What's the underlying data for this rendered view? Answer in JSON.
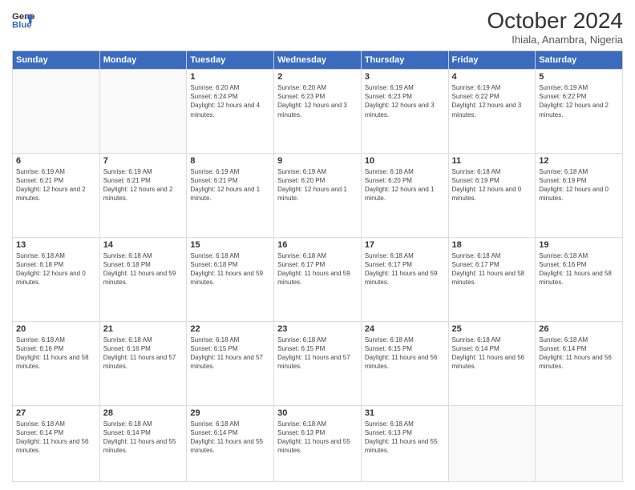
{
  "header": {
    "logo_line1": "General",
    "logo_line2": "Blue",
    "month": "October 2024",
    "location": "Ihiala, Anambra, Nigeria"
  },
  "weekdays": [
    "Sunday",
    "Monday",
    "Tuesday",
    "Wednesday",
    "Thursday",
    "Friday",
    "Saturday"
  ],
  "weeks": [
    [
      {
        "day": "",
        "info": ""
      },
      {
        "day": "",
        "info": ""
      },
      {
        "day": "1",
        "info": "Sunrise: 6:20 AM\nSunset: 6:24 PM\nDaylight: 12 hours and 4 minutes."
      },
      {
        "day": "2",
        "info": "Sunrise: 6:20 AM\nSunset: 6:23 PM\nDaylight: 12 hours and 3 minutes."
      },
      {
        "day": "3",
        "info": "Sunrise: 6:19 AM\nSunset: 6:23 PM\nDaylight: 12 hours and 3 minutes."
      },
      {
        "day": "4",
        "info": "Sunrise: 6:19 AM\nSunset: 6:22 PM\nDaylight: 12 hours and 3 minutes."
      },
      {
        "day": "5",
        "info": "Sunrise: 6:19 AM\nSunset: 6:22 PM\nDaylight: 12 hours and 2 minutes."
      }
    ],
    [
      {
        "day": "6",
        "info": "Sunrise: 6:19 AM\nSunset: 6:21 PM\nDaylight: 12 hours and 2 minutes."
      },
      {
        "day": "7",
        "info": "Sunrise: 6:19 AM\nSunset: 6:21 PM\nDaylight: 12 hours and 2 minutes."
      },
      {
        "day": "8",
        "info": "Sunrise: 6:19 AM\nSunset: 6:21 PM\nDaylight: 12 hours and 1 minute."
      },
      {
        "day": "9",
        "info": "Sunrise: 6:19 AM\nSunset: 6:20 PM\nDaylight: 12 hours and 1 minute."
      },
      {
        "day": "10",
        "info": "Sunrise: 6:18 AM\nSunset: 6:20 PM\nDaylight: 12 hours and 1 minute."
      },
      {
        "day": "11",
        "info": "Sunrise: 6:18 AM\nSunset: 6:19 PM\nDaylight: 12 hours and 0 minutes."
      },
      {
        "day": "12",
        "info": "Sunrise: 6:18 AM\nSunset: 6:19 PM\nDaylight: 12 hours and 0 minutes."
      }
    ],
    [
      {
        "day": "13",
        "info": "Sunrise: 6:18 AM\nSunset: 6:18 PM\nDaylight: 12 hours and 0 minutes."
      },
      {
        "day": "14",
        "info": "Sunrise: 6:18 AM\nSunset: 6:18 PM\nDaylight: 11 hours and 59 minutes."
      },
      {
        "day": "15",
        "info": "Sunrise: 6:18 AM\nSunset: 6:18 PM\nDaylight: 11 hours and 59 minutes."
      },
      {
        "day": "16",
        "info": "Sunrise: 6:18 AM\nSunset: 6:17 PM\nDaylight: 11 hours and 59 minutes."
      },
      {
        "day": "17",
        "info": "Sunrise: 6:18 AM\nSunset: 6:17 PM\nDaylight: 11 hours and 59 minutes."
      },
      {
        "day": "18",
        "info": "Sunrise: 6:18 AM\nSunset: 6:17 PM\nDaylight: 11 hours and 58 minutes."
      },
      {
        "day": "19",
        "info": "Sunrise: 6:18 AM\nSunset: 6:16 PM\nDaylight: 11 hours and 58 minutes."
      }
    ],
    [
      {
        "day": "20",
        "info": "Sunrise: 6:18 AM\nSunset: 6:16 PM\nDaylight: 11 hours and 58 minutes."
      },
      {
        "day": "21",
        "info": "Sunrise: 6:18 AM\nSunset: 6:16 PM\nDaylight: 11 hours and 57 minutes."
      },
      {
        "day": "22",
        "info": "Sunrise: 6:18 AM\nSunset: 6:15 PM\nDaylight: 11 hours and 57 minutes."
      },
      {
        "day": "23",
        "info": "Sunrise: 6:18 AM\nSunset: 6:15 PM\nDaylight: 11 hours and 57 minutes."
      },
      {
        "day": "24",
        "info": "Sunrise: 6:18 AM\nSunset: 6:15 PM\nDaylight: 11 hours and 56 minutes."
      },
      {
        "day": "25",
        "info": "Sunrise: 6:18 AM\nSunset: 6:14 PM\nDaylight: 11 hours and 56 minutes."
      },
      {
        "day": "26",
        "info": "Sunrise: 6:18 AM\nSunset: 6:14 PM\nDaylight: 11 hours and 56 minutes."
      }
    ],
    [
      {
        "day": "27",
        "info": "Sunrise: 6:18 AM\nSunset: 6:14 PM\nDaylight: 11 hours and 56 minutes."
      },
      {
        "day": "28",
        "info": "Sunrise: 6:18 AM\nSunset: 6:14 PM\nDaylight: 11 hours and 55 minutes."
      },
      {
        "day": "29",
        "info": "Sunrise: 6:18 AM\nSunset: 6:14 PM\nDaylight: 11 hours and 55 minutes."
      },
      {
        "day": "30",
        "info": "Sunrise: 6:18 AM\nSunset: 6:13 PM\nDaylight: 11 hours and 55 minutes."
      },
      {
        "day": "31",
        "info": "Sunrise: 6:18 AM\nSunset: 6:13 PM\nDaylight: 11 hours and 55 minutes."
      },
      {
        "day": "",
        "info": ""
      },
      {
        "day": "",
        "info": ""
      }
    ]
  ]
}
